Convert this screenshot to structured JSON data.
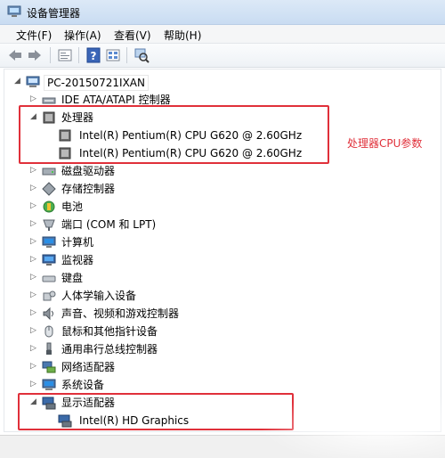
{
  "window": {
    "title": "设备管理器"
  },
  "menu": [
    "文件(F)",
    "操作(A)",
    "查看(V)",
    "帮助(H)"
  ],
  "toolbar": {
    "buttons": [
      "back-arrow-icon",
      "forward-arrow-icon",
      "properties-icon",
      "help-icon",
      "view-icon",
      "scan-hardware-icon"
    ]
  },
  "tree": {
    "root": "PC-20150721IXAN",
    "items": [
      {
        "label": "IDE ATA/ATAPI 控制器",
        "icon": "ide-controller-icon",
        "expanded": false
      },
      {
        "label": "处理器",
        "icon": "processor-icon",
        "expanded": true,
        "children": [
          "Intel(R) Pentium(R) CPU G620 @ 2.60GHz",
          "Intel(R) Pentium(R) CPU G620 @ 2.60GHz"
        ]
      },
      {
        "label": "磁盘驱动器",
        "icon": "disk-drive-icon",
        "expanded": false
      },
      {
        "label": "存储控制器",
        "icon": "storage-controller-icon",
        "expanded": false
      },
      {
        "label": "电池",
        "icon": "battery-icon",
        "expanded": false
      },
      {
        "label": "端口 (COM 和 LPT)",
        "icon": "port-icon",
        "expanded": false
      },
      {
        "label": "计算机",
        "icon": "computer-icon",
        "expanded": false
      },
      {
        "label": "监视器",
        "icon": "monitor-icon",
        "expanded": false
      },
      {
        "label": "键盘",
        "icon": "keyboard-icon",
        "expanded": false
      },
      {
        "label": "人体学输入设备",
        "icon": "hid-icon",
        "expanded": false
      },
      {
        "label": "声音、视频和游戏控制器",
        "icon": "sound-icon",
        "expanded": false
      },
      {
        "label": "鼠标和其他指针设备",
        "icon": "mouse-icon",
        "expanded": false
      },
      {
        "label": "通用串行总线控制器",
        "icon": "usb-icon",
        "expanded": false
      },
      {
        "label": "网络适配器",
        "icon": "network-adapter-icon",
        "expanded": false
      },
      {
        "label": "系统设备",
        "icon": "system-device-icon",
        "expanded": false
      },
      {
        "label": "显示适配器",
        "icon": "display-adapter-icon",
        "expanded": true,
        "children": [
          "Intel(R) HD Graphics"
        ]
      }
    ]
  },
  "annotation": {
    "text": "处理器CPU参数",
    "color": "#e0303a"
  },
  "colors": {
    "highlight": "#e0303a",
    "titlebar": "#c9dcf2"
  }
}
